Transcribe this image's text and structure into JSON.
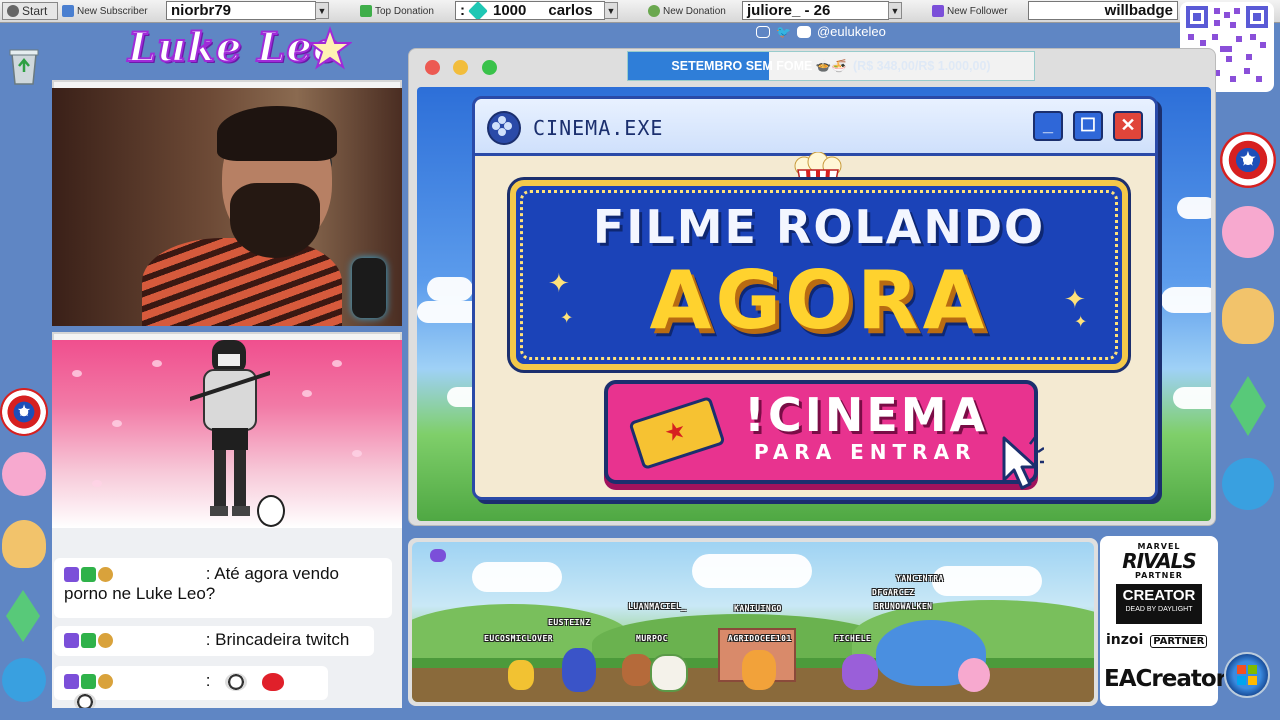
{
  "taskbar": {
    "start_label": "Start",
    "subscriber_label": "New Subscriber",
    "subscriber_value": "niorbr79",
    "donation_label": "Top Donation",
    "donation_amount": "1000",
    "donation_user": "carlos",
    "new_donation_label": "New Donation",
    "new_donation_value": "juliore_ - 26",
    "follower_label": "New Follower",
    "follower_value": "willbadge"
  },
  "logo": {
    "text": "Luke Leo"
  },
  "social": {
    "handle": "@eulukeleo"
  },
  "goal": {
    "title": "SETEMBRO SEM FOME 🍲🍜",
    "amount": "(R$ 348,00/R$ 1.000,00)",
    "fraction": 0.348
  },
  "cinema_window": {
    "title": "CINEMA.EXE",
    "headline_top": "FILME ROLANDO",
    "headline_big": "AGORA",
    "command": "!CINEMA",
    "command_sub": "PARA ENTRAR"
  },
  "chat": {
    "messages": [
      {
        "text": ": Até agora vendo porno ne Luke Leo?"
      },
      {
        "text": ": Brincadeira twitch"
      },
      {
        "text": ":"
      }
    ]
  },
  "game": {
    "usernames": [
      "EUCOSMICLOVER",
      "EUSTEINZ",
      "LUANMACIEL_",
      "MURPOC",
      "KANIUINGO",
      "AGRIDOCEE101",
      "FICHELE",
      "YANCINTRA",
      "DFGARCEZ",
      "BRUNOWALKEN"
    ]
  },
  "partner": {
    "rivals_small": "MARVEL",
    "rivals": "RIVALS",
    "rivals_sub": "PARTNER",
    "creator": "CREATOR",
    "creator_sub": "DEAD BY DAYLIGHT",
    "inzoi": "inzoi",
    "inzoi_sub": "PARTNER",
    "ea": "EACreator"
  },
  "colors": {
    "background": "#5f86c4",
    "goal_fill": "#2f7ed8",
    "cinema_button": "#e8338f",
    "marquee_gold": "#ffd22e"
  }
}
